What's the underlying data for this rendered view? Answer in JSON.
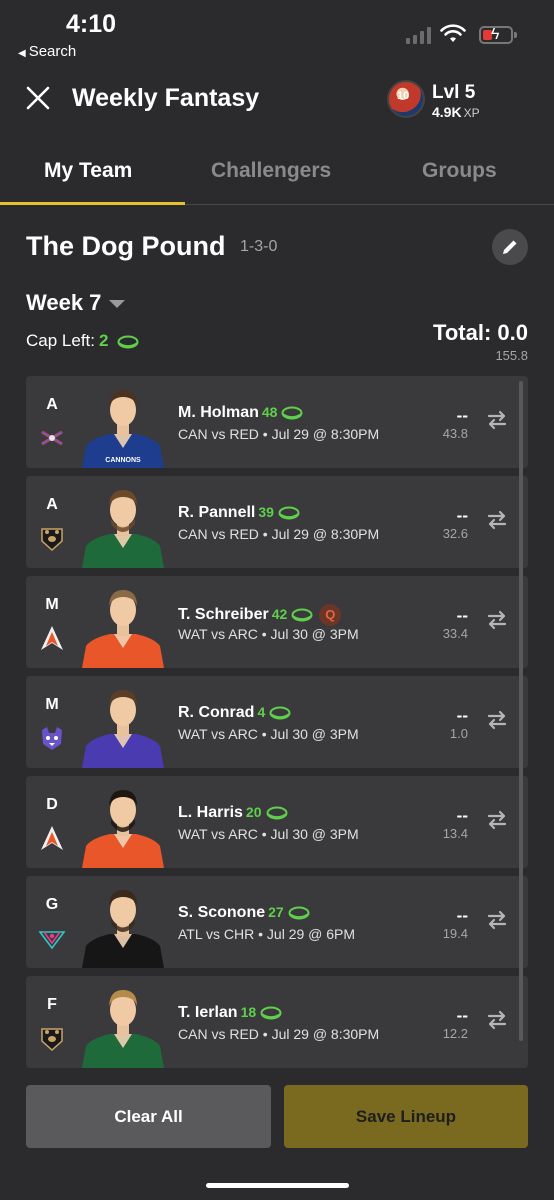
{
  "status_bar": {
    "time": "4:10",
    "back_label": "Search"
  },
  "header": {
    "title": "Weekly Fantasy",
    "avatar_number": "10",
    "level": "Lvl 5",
    "xp_value": "4.9K",
    "xp_unit": "XP"
  },
  "tabs": [
    {
      "label": "My Team",
      "active": true
    },
    {
      "label": "Challengers",
      "active": false
    },
    {
      "label": "Groups",
      "active": false
    }
  ],
  "team": {
    "name": "The Dog Pound",
    "record": "1-3-0",
    "week": "Week 7",
    "cap_label": "Cap Left:",
    "cap_value": "2",
    "total": "Total: 0.0",
    "total_projected": "155.8"
  },
  "players": [
    {
      "pos": "A",
      "name": "M. Holman",
      "cost": "48",
      "game": "CAN vs RED • Jul 29 @ 8:30PM",
      "score": "--",
      "proj": "43.8",
      "jersey": "#1f3d8f",
      "jersey_text": "CANNONS",
      "team_logo": "cannons-logo-icon",
      "hair": "#4a3322",
      "beard": false,
      "questionable": false
    },
    {
      "pos": "A",
      "name": "R. Pannell",
      "cost": "39",
      "game": "CAN vs RED • Jul 29 @ 8:30PM",
      "score": "--",
      "proj": "32.6",
      "jersey": "#1f6a3b",
      "jersey_text": "",
      "team_logo": "redwoods-bear-icon",
      "hair": "#6b4a2a",
      "beard": true,
      "questionable": false
    },
    {
      "pos": "M",
      "name": "T. Schreiber",
      "cost": "42",
      "game": "WAT vs ARC • Jul 30 @ 3PM",
      "score": "--",
      "proj": "33.4",
      "jersey": "#e8562a",
      "jersey_text": "",
      "team_logo": "archers-arrow-icon",
      "hair": "#8a6a44",
      "beard": false,
      "questionable": true,
      "q_label": "Q"
    },
    {
      "pos": "M",
      "name": "R. Conrad",
      "cost": "4",
      "game": "WAT vs ARC • Jul 30 @ 3PM",
      "score": "--",
      "proj": "1.0",
      "jersey": "#4a3bb0",
      "jersey_text": "",
      "team_logo": "waterdogs-dog-icon",
      "hair": "#5a3e25",
      "beard": false,
      "questionable": false
    },
    {
      "pos": "D",
      "name": "L. Harris",
      "cost": "20",
      "game": "WAT vs ARC • Jul 30 @ 3PM",
      "score": "--",
      "proj": "13.4",
      "jersey": "#e8562a",
      "jersey_text": "",
      "team_logo": "archers-arrow-icon",
      "hair": "#1e1610",
      "beard": true,
      "questionable": false
    },
    {
      "pos": "G",
      "name": "S. Sconone",
      "cost": "27",
      "game": "ATL vs CHR • Jul 29 @ 6PM",
      "score": "--",
      "proj": "19.4",
      "jersey": "#161616",
      "jersey_text": "",
      "team_logo": "chrome-logo-icon",
      "hair": "#3a2a1c",
      "beard": true,
      "questionable": false
    },
    {
      "pos": "F",
      "name": "T. Ierlan",
      "cost": "18",
      "game": "CAN vs RED • Jul 29 @ 8:30PM",
      "score": "--",
      "proj": "12.2",
      "jersey": "#1f6a3b",
      "jersey_text": "",
      "team_logo": "redwoods-bear-icon",
      "hair": "#b58a4a",
      "beard": false,
      "questionable": false
    }
  ],
  "footer": {
    "clear_label": "Clear All",
    "save_label": "Save Lineup"
  },
  "colors": {
    "accent": "#e5c12c",
    "cost_green": "#5fcf4c",
    "card_bg": "#3a3a3c",
    "save_bg": "#7a6a1f"
  }
}
